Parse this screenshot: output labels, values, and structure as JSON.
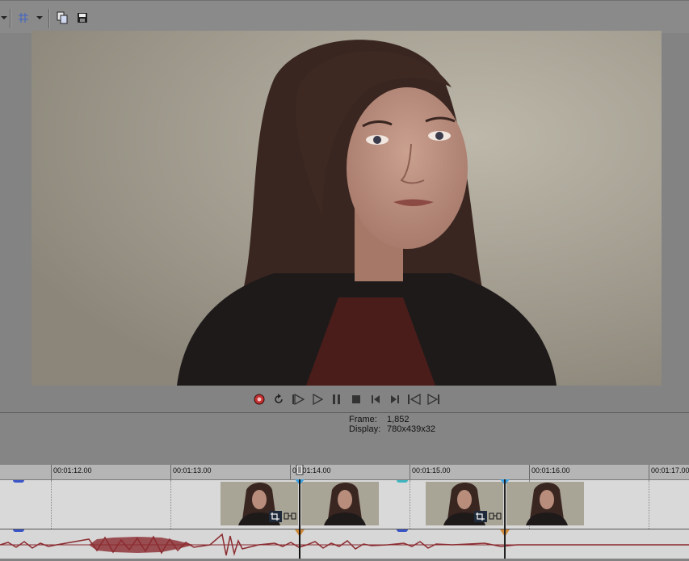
{
  "toolbar": {
    "icons": [
      "dropdown-arrow-icon",
      "grid-icon",
      "dropdown-arrow-icon",
      "copy-snapshot-icon",
      "save-snapshot-icon"
    ]
  },
  "transport": {
    "buttons": [
      "record",
      "loop",
      "play-from-start",
      "play",
      "pause",
      "stop",
      "prev-frame",
      "next-frame",
      "prev-event",
      "next-event"
    ]
  },
  "info": {
    "frame_label": "Frame:",
    "frame_value": "1,852",
    "display_label": "Display:",
    "display_value": "780x439x32"
  },
  "ruler": {
    "ticks": [
      "00:01:12.00",
      "00:01:13.00",
      "00:01:14.00",
      "00:01:15.00",
      "00:01:16.00",
      "00:01:17.00"
    ]
  },
  "colors": {
    "waveform": "#8b2b30",
    "fade_marker": "#3a55c9",
    "cursor": "#111111",
    "record": "#c33131"
  }
}
